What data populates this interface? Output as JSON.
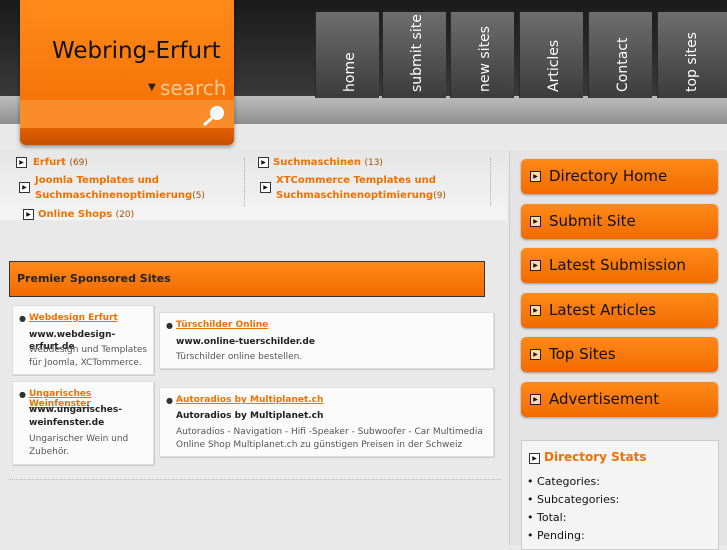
{
  "header": {
    "site_title": "Webring-Erfurt",
    "search_label": "search",
    "nav": [
      "home",
      "submit site",
      "new sites",
      "Articles",
      "Contact",
      "top sites"
    ]
  },
  "categories": [
    {
      "name": "Erfurt",
      "count": "(69)"
    },
    {
      "name": "Suchmaschinen",
      "count": "(13)"
    },
    {
      "name_line1": "Joomla Templates und",
      "name_line2": "Suchmaschinenoptimierung",
      "count": "(5)"
    },
    {
      "name_line1": "XTCommerce Templates und",
      "name_line2": "Suchmaschinenoptimierung",
      "count": "(9)"
    },
    {
      "name": "Online Shops",
      "count": "(20)"
    }
  ],
  "sponsored": {
    "title": "Premier Sponsored Sites",
    "listings": [
      {
        "title": "Webdesign Erfurt",
        "url": "www.webdesign-erfurt.de",
        "desc_line1": "Webdesign und Templates",
        "desc_line2": "für Joomla, XCTommerce."
      },
      {
        "title": "Türschilder Online",
        "url": "www.online-tuerschilder.de",
        "desc_line1": "Türschilder online bestellen."
      },
      {
        "title": "Ungarisches Weinfenster",
        "url_line1": "www.ungarisches-",
        "url_line2": "weinfenster.de",
        "desc_line1": "Ungarischer Wein und",
        "desc_line2": "Zubehör."
      },
      {
        "title": "Autoradios by Multiplanet.ch",
        "url": "Autoradios by Multiplanet.ch",
        "desc_line1": "Autoradios - Navigation - Hifi -Speaker - Subwoofer - Car Multimedia",
        "desc_line2": "Online Shop Multiplanet.ch zu günstigen Preisen in der Schweiz"
      }
    ]
  },
  "sidebar": {
    "buttons": [
      "Directory Home",
      "Submit Site",
      "Latest Submission",
      "Latest Articles",
      "Top Sites",
      "Advertisement"
    ],
    "stats_title": "Directory Stats",
    "stats": [
      "Categories:",
      "Subcategories:",
      "Total:",
      "Pending:"
    ]
  },
  "colors": {
    "accent": "#f26a00",
    "header_dark": "#2a2a2a"
  }
}
